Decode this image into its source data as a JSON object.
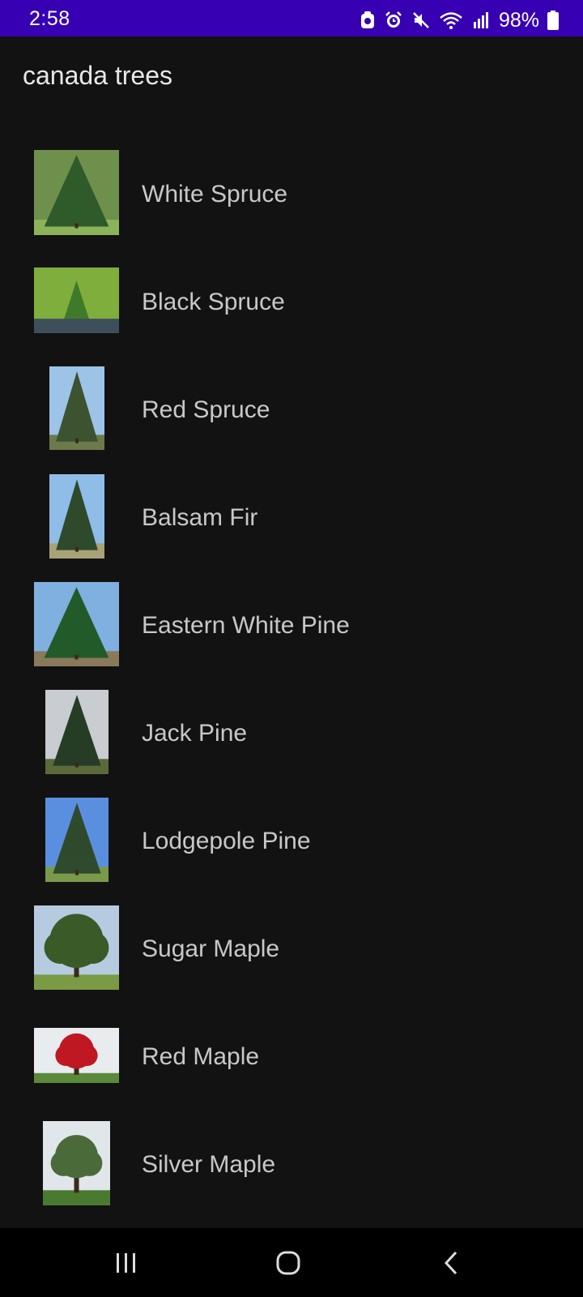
{
  "status_bar": {
    "time": "2:58",
    "battery": "98%",
    "icons": [
      "bixby-routine-icon",
      "alarm-icon",
      "mute-icon",
      "wifi-icon",
      "cell-signal-icon",
      "battery-icon"
    ],
    "background": "#3700b3"
  },
  "app_bar": {
    "title": "canada trees"
  },
  "trees": [
    {
      "name": "White Spruce",
      "thumb": "white-spruce-photo",
      "shape": "conifer",
      "sky": "#6f8f4d",
      "tree": "#2f5a2a",
      "ground": "#8db35a"
    },
    {
      "name": "Black Spruce",
      "thumb": "black-spruce-photo",
      "shape": "marsh",
      "sky": "#7fae3c",
      "tree": "#3f7a2a",
      "ground": "#3d4f5a"
    },
    {
      "name": "Red Spruce",
      "thumb": "red-spruce-photo",
      "shape": "conifer",
      "sky": "#9dc3e6",
      "tree": "#3d5230",
      "ground": "#6b7a4a"
    },
    {
      "name": "Balsam Fir",
      "thumb": "balsam-fir-photo",
      "shape": "conifer",
      "sky": "#8fbde8",
      "tree": "#2e4a2c",
      "ground": "#a8a377"
    },
    {
      "name": "Eastern White Pine",
      "thumb": "eastern-white-pine-photo",
      "shape": "pine",
      "sky": "#7fb0e0",
      "tree": "#235a2a",
      "ground": "#8a7a5a"
    },
    {
      "name": "Jack Pine",
      "thumb": "jack-pine-photo",
      "shape": "pine",
      "sky": "#c9ccd0",
      "tree": "#263c26",
      "ground": "#5a6a3a"
    },
    {
      "name": "Lodgepole Pine",
      "thumb": "lodgepole-pine-photo",
      "shape": "conifer",
      "sky": "#5a8fe0",
      "tree": "#2f4a2c",
      "ground": "#7a9a4a"
    },
    {
      "name": "Sugar Maple",
      "thumb": "sugar-maple-photo",
      "shape": "broadleaf",
      "sky": "#b7cbe0",
      "tree": "#3a5a28",
      "ground": "#7a9a45"
    },
    {
      "name": "Red Maple",
      "thumb": "red-maple-photo",
      "shape": "broadleaf",
      "sky": "#e8ecef",
      "tree": "#c01822",
      "ground": "#5a8a3a"
    },
    {
      "name": "Silver Maple",
      "thumb": "silver-maple-photo",
      "shape": "broadleaf",
      "sky": "#e0e6ea",
      "tree": "#4a6a3a",
      "ground": "#4a7a30"
    }
  ],
  "nav_bar": {
    "buttons": [
      "recent-apps",
      "home",
      "back"
    ]
  }
}
